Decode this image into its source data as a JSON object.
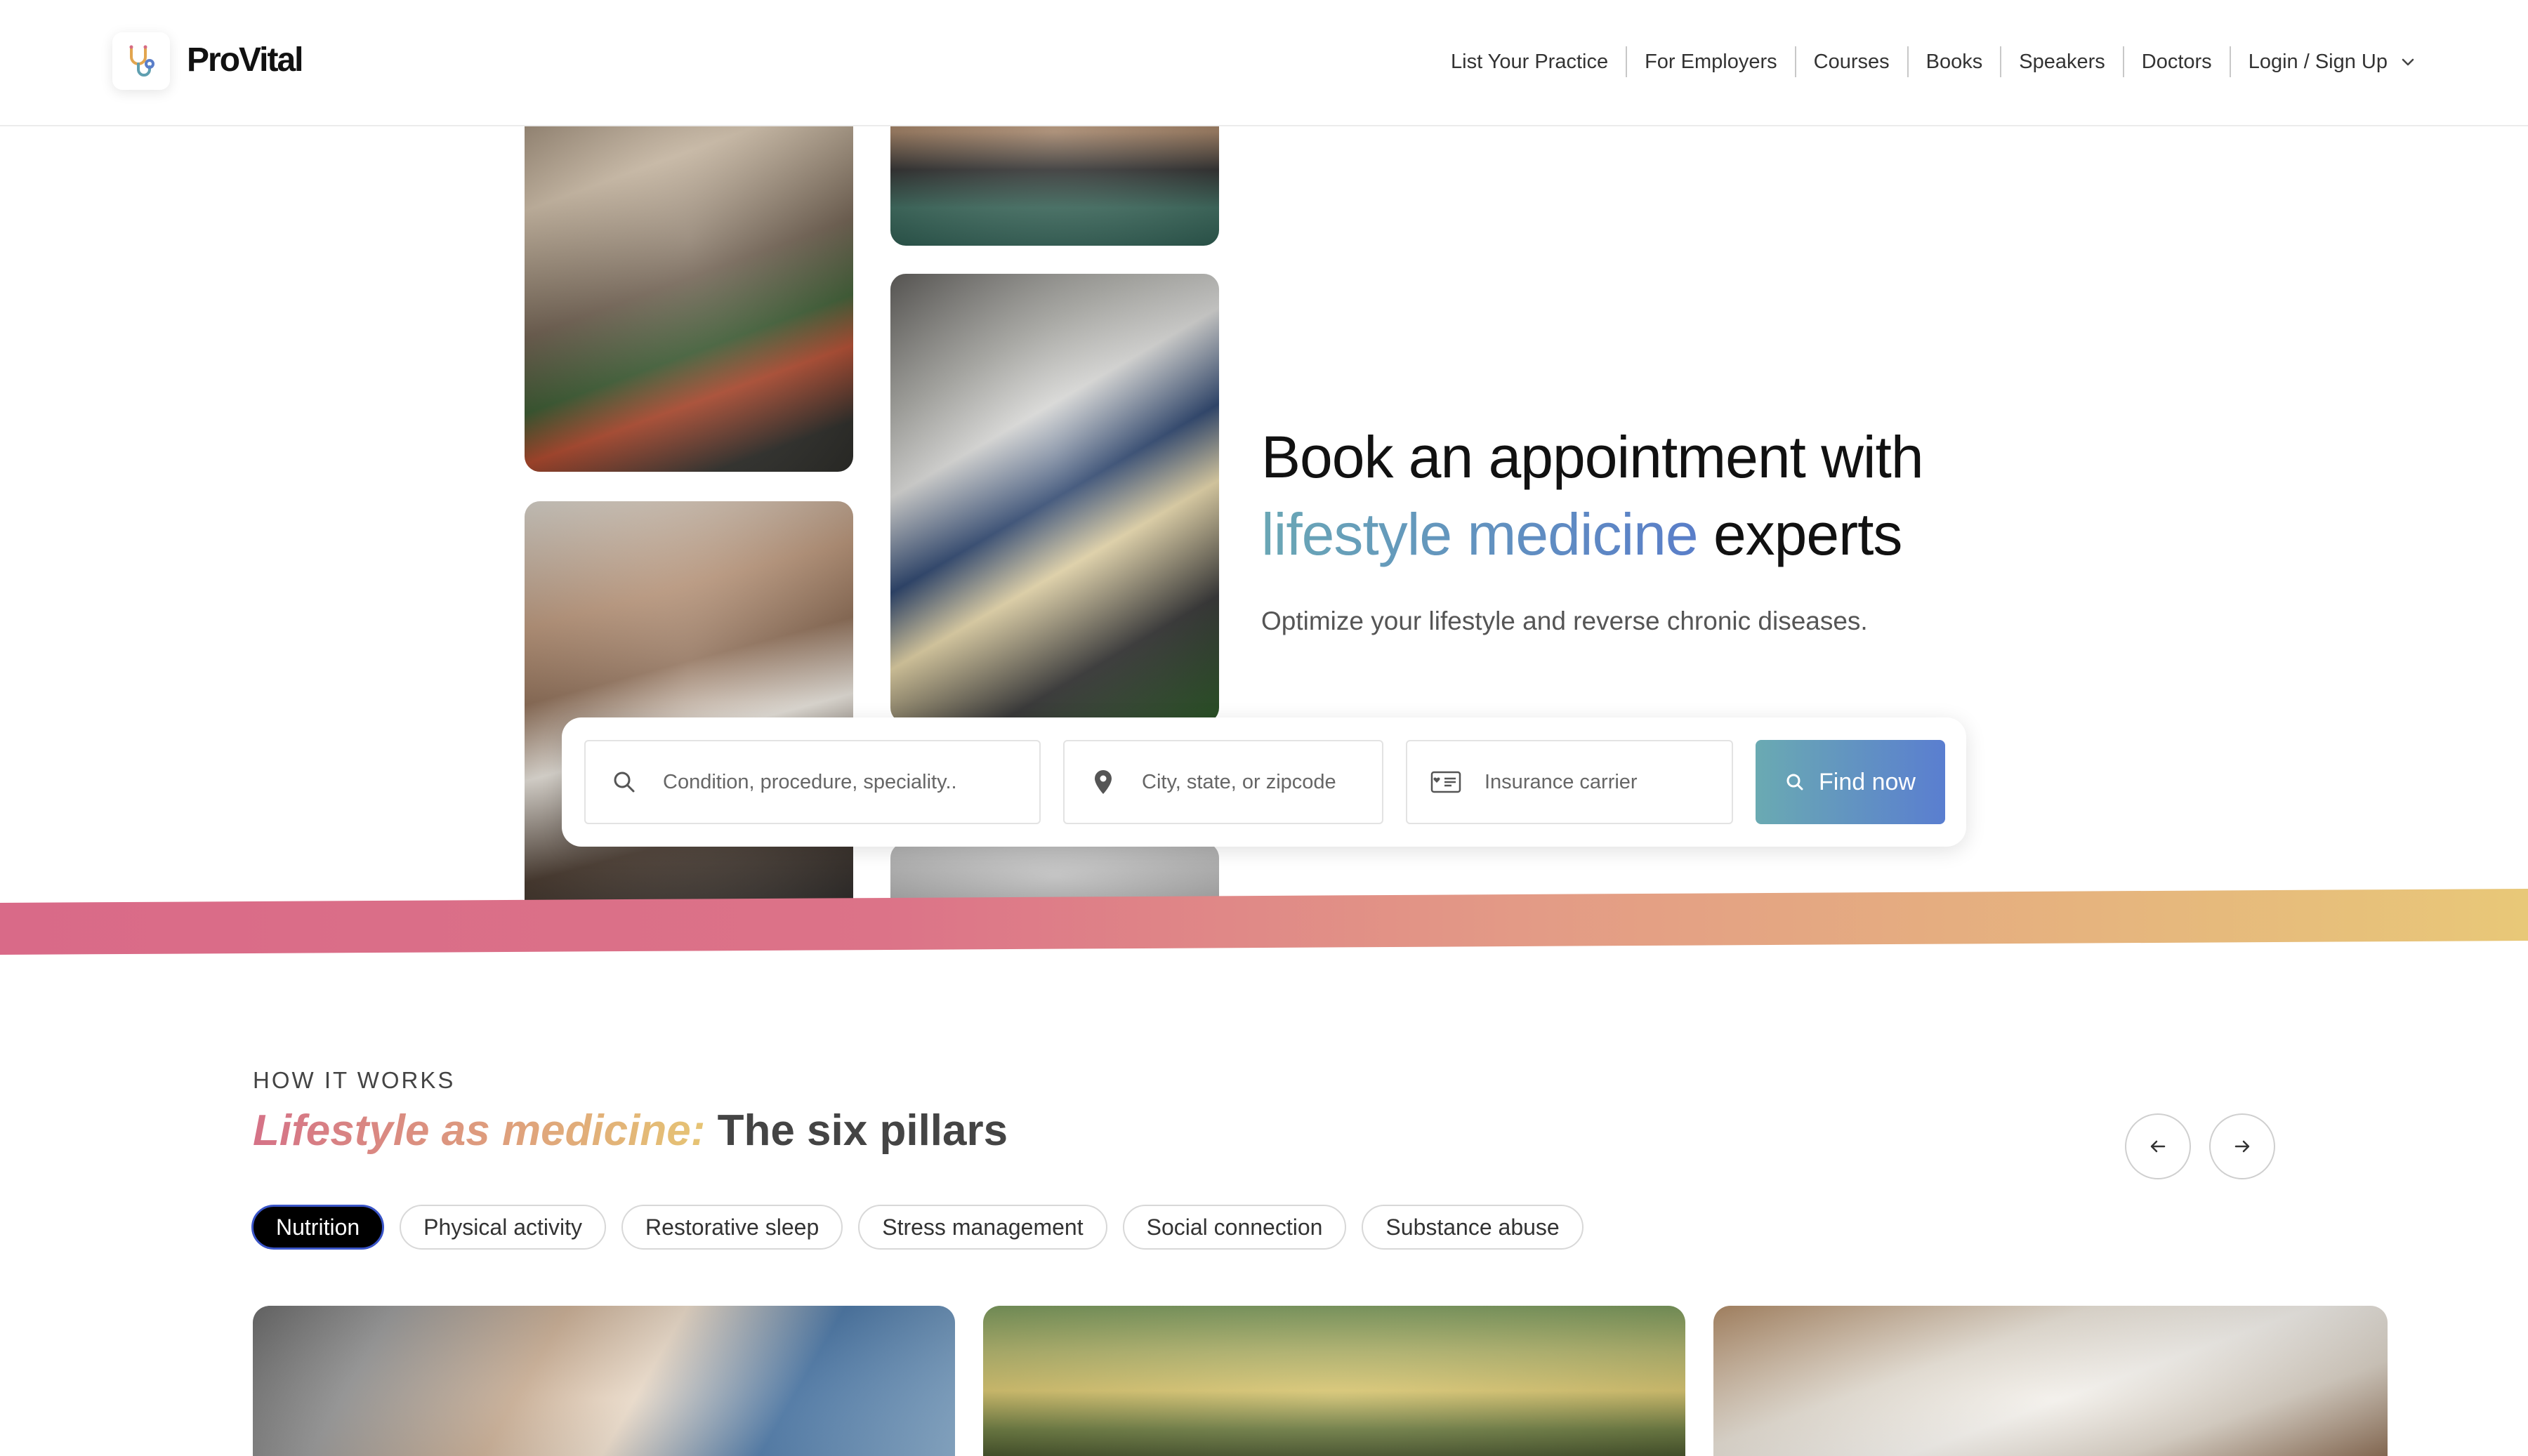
{
  "brand": {
    "name": "ProVital",
    "logo_icon": "stethoscope-icon"
  },
  "nav": {
    "items": [
      "List Your Practice",
      "For Employers",
      "Courses",
      "Books",
      "Speakers",
      "Doctors"
    ],
    "login_label": "Login / Sign Up"
  },
  "hero": {
    "title_line1": "Book an appointment with",
    "title_highlight": "lifestyle medicine",
    "title_rest": " experts",
    "subtitle": "Optimize your lifestyle and reverse chronic diseases."
  },
  "search": {
    "condition_placeholder": "Condition, procedure, speciality..",
    "location_placeholder": "City, state, or zipcode",
    "insurance_placeholder": "Insurance carrier",
    "button_label": "Find now"
  },
  "how_it_works": {
    "eyebrow": "HOW IT WORKS",
    "title_highlight": "Lifestyle as medicine:",
    "title_rest": " The six pillars",
    "tabs": [
      "Nutrition",
      "Physical activity",
      "Restorative sleep",
      "Stress management",
      "Social connection",
      "Substance abuse"
    ],
    "active_tab": "Nutrition"
  },
  "colors": {
    "accent_blue": "#5a7ec9",
    "accent_teal": "#6aa7b5",
    "stripe_pink": "#d96a88",
    "stripe_gold": "#e8c878",
    "active_tab_border": "#3a55c8"
  }
}
